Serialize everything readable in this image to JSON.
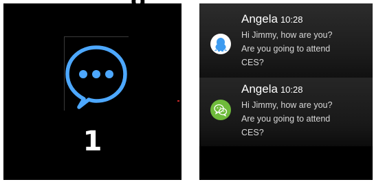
{
  "title_fragment": "g",
  "left_screen": {
    "icon": "chat-bubble-icon",
    "unread_count": "1",
    "accent_color": "#4da8ff"
  },
  "right_screen": {
    "notifications": [
      {
        "name": "Angela",
        "time": "10:28",
        "line1": "Hi Jimmy, how are you?",
        "line2": "Are you going to attend",
        "line3": "CES?",
        "avatar_icon": "penguin-avatar-icon",
        "avatar_color": "#ffffff",
        "icon_color": "#3d9bf0"
      },
      {
        "name": "Angela",
        "time": "10:28",
        "line1": "Hi Jimmy, how are you?",
        "line2": "Are you going to attend",
        "line3": "CES?",
        "avatar_icon": "wechat-avatar-icon",
        "avatar_color": "#6fbb3b",
        "icon_color": "#ffffff"
      }
    ]
  }
}
